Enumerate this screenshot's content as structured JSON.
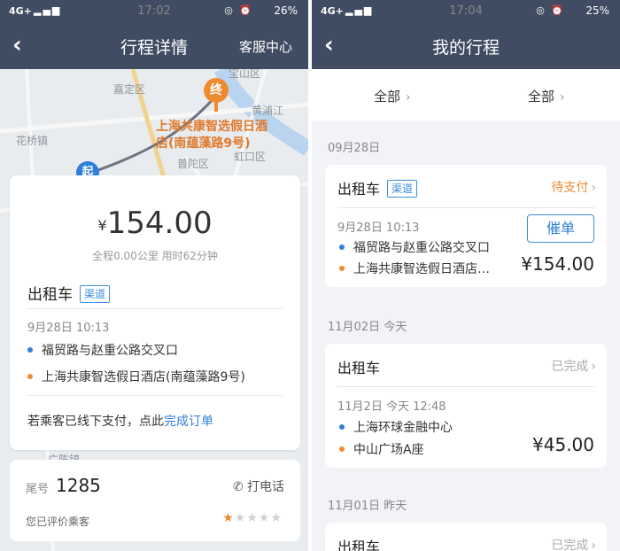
{
  "left": {
    "status": {
      "net": "4G+",
      "time": "17:02",
      "battery": "26%",
      "net_small": "4G"
    },
    "nav": {
      "back": "‹",
      "title": "行程详情",
      "right_action": "客服中心"
    },
    "map": {
      "labels": [
        "宝山区",
        "嘉定区",
        "黄浦江",
        "花桥镇",
        "普陀区",
        "虹口区",
        "广陈镇"
      ],
      "dest_pin": "终",
      "start_pin": "起",
      "destination": "上海共康智选假日酒店(南蕴藻路9号)"
    },
    "trip": {
      "currency": "¥",
      "price": "154.00",
      "summary": "全程0.00公里 用时62分钟",
      "service": "出租车",
      "tag": "渠道",
      "datetime": "9月28日 10:13",
      "from": "福贸路与赵重公路交叉口",
      "to": "上海共康智选假日酒店(南蕴藻路9号)",
      "offline_text": "若乘客已线下支付，点此",
      "offline_link": "完成订单"
    },
    "driver": {
      "tail_label": "尾号",
      "tail_number": "1285",
      "call": "打电话",
      "rated": "您已评价乘客",
      "rating": 1,
      "max_rating": 5
    }
  },
  "right": {
    "status": {
      "net": "4G+",
      "time": "17:04",
      "battery": "25%",
      "net_small": "4G"
    },
    "nav": {
      "back": "‹",
      "title": "我的行程"
    },
    "filters": [
      "全部",
      "全部"
    ],
    "groups": [
      {
        "date": "09月28日",
        "service": "出租车",
        "tag": "渠道",
        "status": "待支付",
        "action": "催单",
        "datetime": "9月28日 10:13",
        "from": "福贸路与赵重公路交叉口",
        "to": "上海共康智选假日酒店…",
        "amount": "¥154.00"
      },
      {
        "date": "11月02日 今天",
        "service": "出租车",
        "status": "已完成",
        "datetime": "11月2日 今天 12:48",
        "from": "上海环球金融中心",
        "to": "中山广场A座",
        "amount": "¥45.00"
      },
      {
        "date": "11月01日 昨天",
        "service": "出租车",
        "status": "已完成"
      }
    ]
  },
  "colors": {
    "navbar": "#3f4c62",
    "accent_blue": "#2f7fd8",
    "accent_orange": "#f08a31"
  }
}
